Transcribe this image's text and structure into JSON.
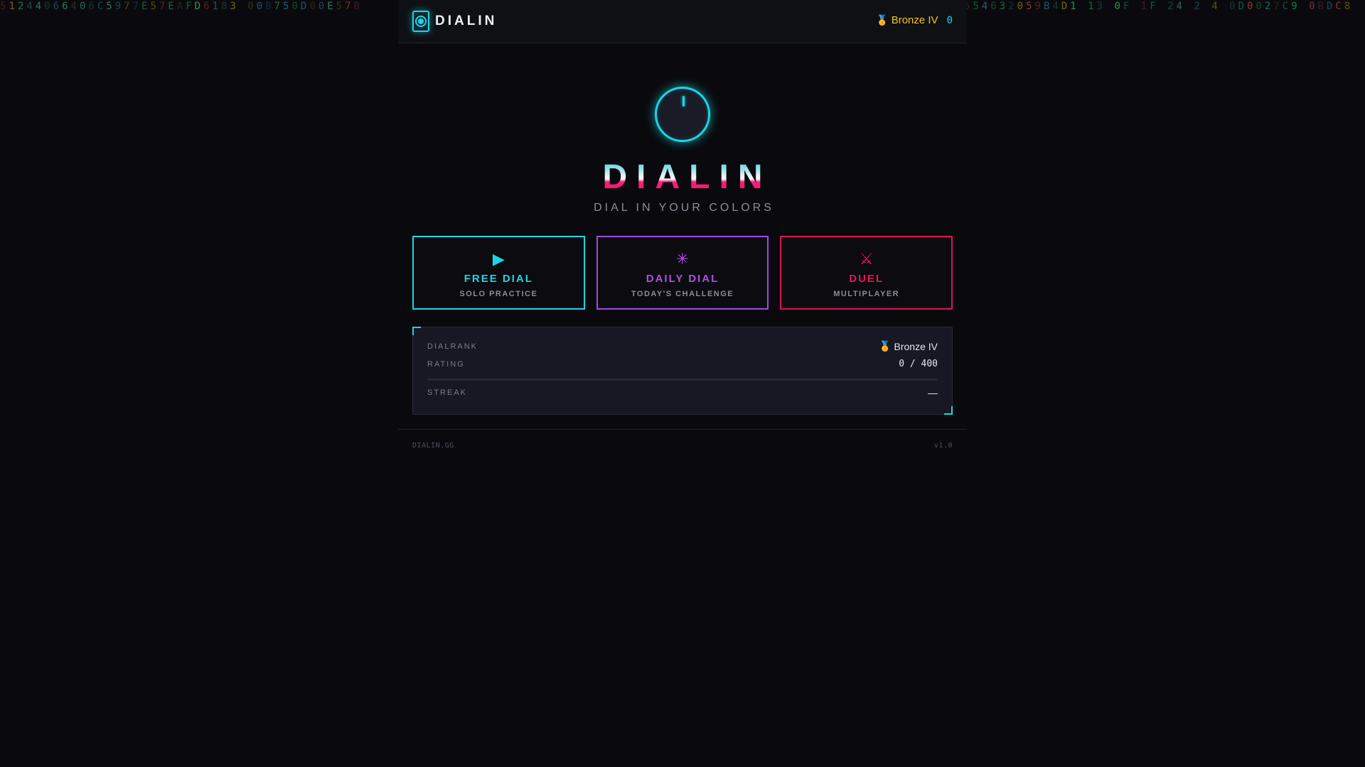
{
  "background_hex_left": "51244066406C5977E57EAFD6183 00B750D00E57B",
  "background_hex_right": "554632059B4D1 13 0F 1F 24 2 4 0D0027C9 0BDC8",
  "topbar": {
    "logo_text": "DIALIN",
    "rank": "Bronze IV",
    "score": "0"
  },
  "hero": {
    "title": "DIALIN",
    "tagline": "DIAL IN YOUR COLORS"
  },
  "modes": [
    {
      "icon": "play-icon",
      "glyph": "▶",
      "label": "FREE DIAL",
      "sub": "SOLO PRACTICE",
      "color": "#1bd6e6"
    },
    {
      "icon": "sparkle-icon",
      "glyph": "✳",
      "label": "DAILY DIAL",
      "sub": "TODAY'S CHALLENGE",
      "color": "#b04fe8"
    },
    {
      "icon": "crossed-swords-icon",
      "glyph": "⚔",
      "label": "DUEL",
      "sub": "MULTIPLAYER",
      "color": "#ee1558"
    }
  ],
  "stats": {
    "dialrank_label": "DIALRANK",
    "dialrank_value": "Bronze IV",
    "rating_label": "RATING",
    "rating_value": "0 / 400",
    "rating_progress": 0,
    "streak_label": "STREAK",
    "streak_value": "—"
  },
  "footer": {
    "left": "DIALIN.GG",
    "right": "v1.0"
  },
  "colors": {
    "accent_cyan": "#1bd6e6",
    "accent_purple": "#b04fe8",
    "accent_red": "#ee1558",
    "rank_gold": "#f5c518"
  }
}
